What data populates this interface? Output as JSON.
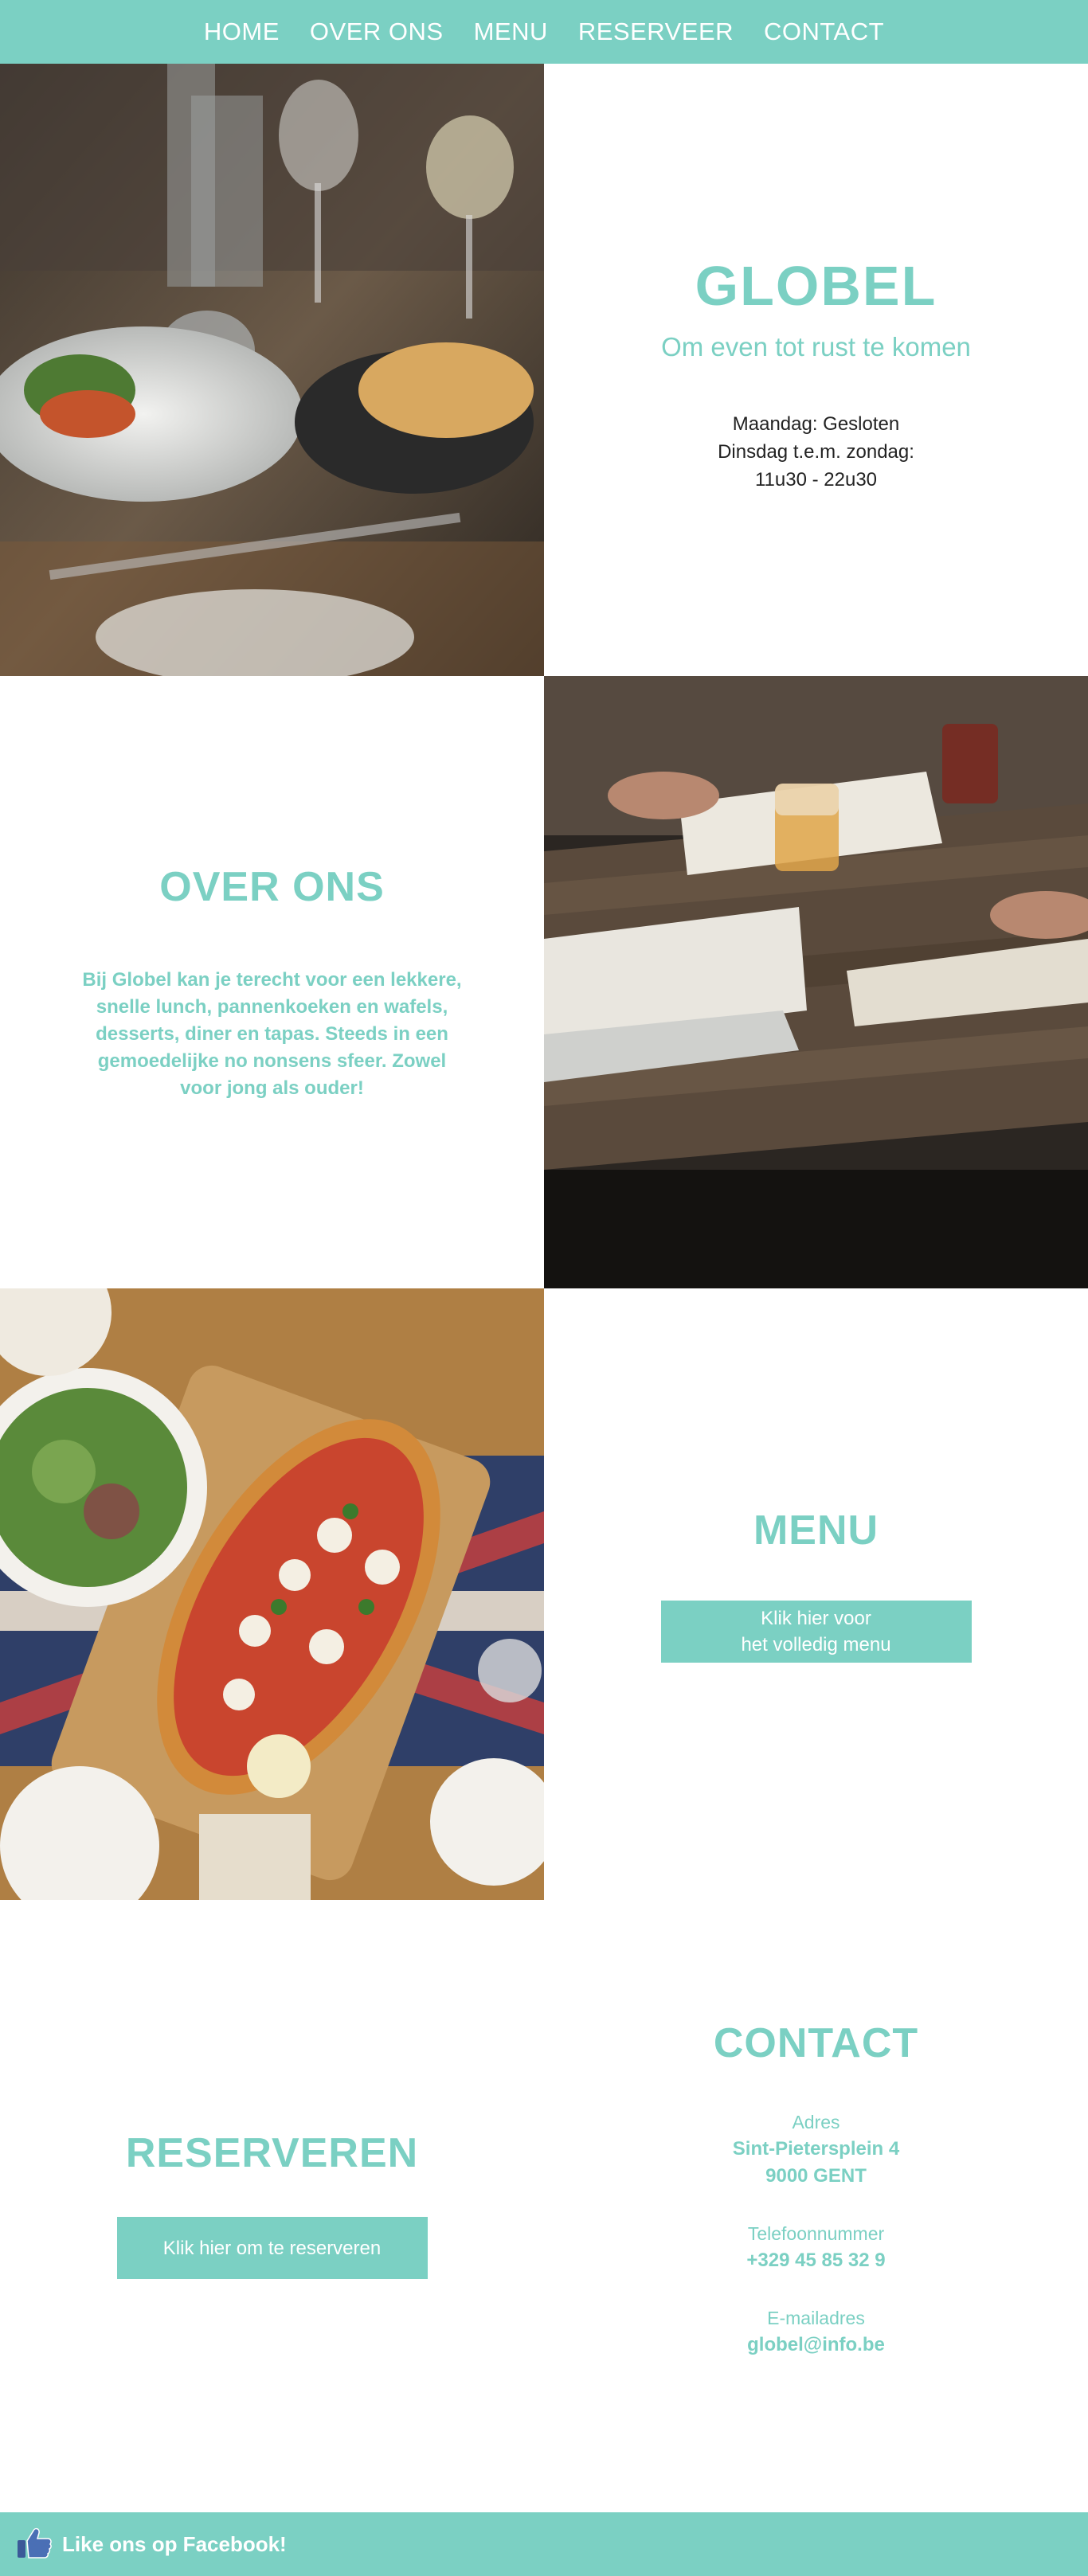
{
  "nav": {
    "items": [
      "HOME",
      "OVER ONS",
      "MENU",
      "RESERVEER",
      "CONTACT"
    ]
  },
  "hero": {
    "title": "GLOBEL",
    "tagline": "Om even tot rust te komen",
    "hours": [
      "Maandag: Gesloten",
      "Dinsdag t.e.m. zondag:",
      "11u30 - 22u30"
    ]
  },
  "about": {
    "title": "OVER ONS",
    "text": "Bij Globel kan je terecht voor een lekkere, snelle lunch, pannenkoeken en wafels, desserts, diner en tapas. Steeds in een gemoedelijke no nonsens sfeer. Zowel voor jong als ouder!"
  },
  "menu": {
    "title": "MENU",
    "button_line1": "Klik hier voor",
    "button_line2": "het volledig menu"
  },
  "reserve": {
    "title": "RESERVEREN",
    "button": "Klik hier om te reserveren"
  },
  "contact": {
    "title": "CONTACT",
    "address_label": "Adres",
    "address_line1": "Sint-Pietersplein 4",
    "address_line2": "9000 GENT",
    "phone_label": "Telefoonnummer",
    "phone": "+329 45 85 32 9",
    "email_label": "E-mailadres",
    "email": "globel@info.be"
  },
  "footer": {
    "text": "Like ons op Facebook!"
  },
  "colors": {
    "accent": "#7bd0c3",
    "text": "#222222",
    "background": "#ffffff"
  }
}
